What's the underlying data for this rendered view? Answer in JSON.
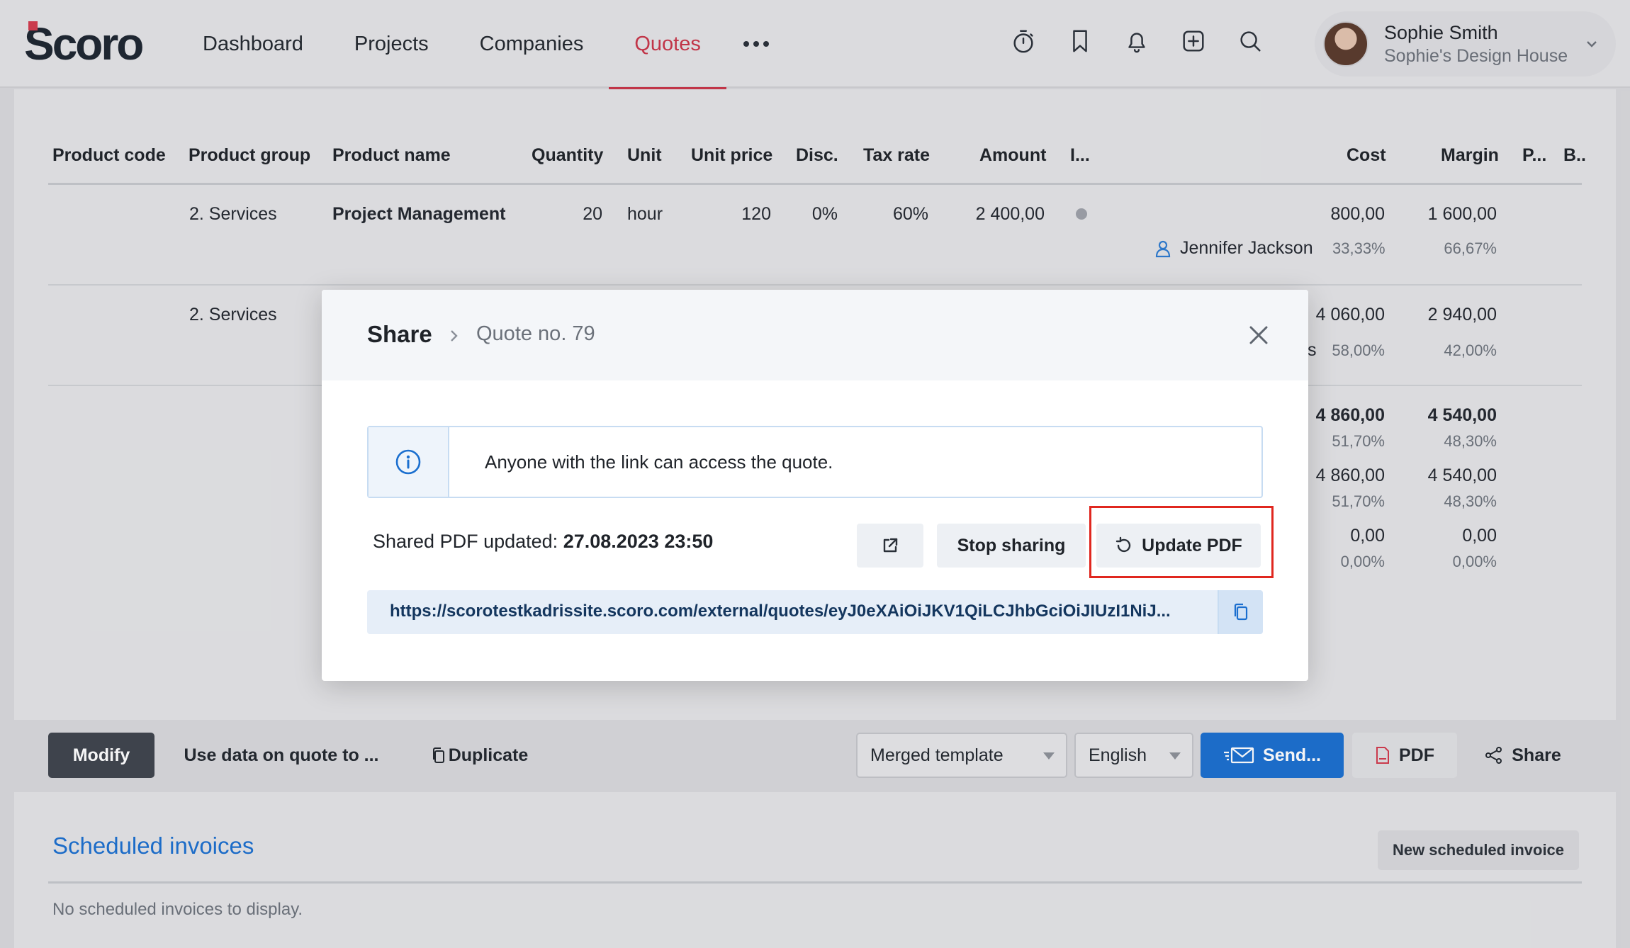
{
  "app": {
    "logo": "Scoro"
  },
  "nav": {
    "items": [
      "Dashboard",
      "Projects",
      "Companies",
      "Quotes"
    ],
    "active": "Quotes"
  },
  "user": {
    "name": "Sophie Smith",
    "company": "Sophie's Design House"
  },
  "table": {
    "headers": [
      "Product code",
      "Product group",
      "Product name",
      "Quantity",
      "Unit",
      "Unit price",
      "Disc.",
      "Tax rate",
      "Amount",
      "I...",
      "Cost",
      "Margin",
      "P...",
      "B.."
    ],
    "rows": [
      {
        "group": "2. Services",
        "name": "Project Management",
        "quantity": "20",
        "unit": "hour",
        "unit_price": "120",
        "discount": "0%",
        "tax_rate": "60%",
        "amount": "2 400,00",
        "cost": "800,00",
        "margin": "1 600,00",
        "person": "Jennifer Jackson",
        "cost_pct": "33,33%",
        "margin_pct": "66,67%"
      },
      {
        "group": "2. Services",
        "cost": "4 060,00",
        "margin": "2 940,00",
        "person_tail": "s",
        "cost_pct": "58,00%",
        "margin_pct": "42,00%"
      }
    ],
    "totals": [
      {
        "cost": "4 860,00",
        "margin": "4 540,00",
        "cost_pct": "51,70%",
        "margin_pct": "48,30%"
      },
      {
        "cost": "4 860,00",
        "margin": "4 540,00",
        "cost_pct": "51,70%",
        "margin_pct": "48,30%"
      },
      {
        "cost": "0,00",
        "margin": "0,00",
        "cost_pct": "0,00%",
        "margin_pct": "0,00%"
      }
    ]
  },
  "toolbar": {
    "modify": "Modify",
    "use_data": "Use data on quote to ...",
    "duplicate": "Duplicate",
    "template": "Merged template",
    "language": "English",
    "send": "Send...",
    "pdf": "PDF",
    "share": "Share"
  },
  "scheduled": {
    "title": "Scheduled invoices",
    "new_button": "New scheduled invoice",
    "empty": "No scheduled invoices to display."
  },
  "modal": {
    "title": "Share",
    "breadcrumb": "Quote no. 79",
    "info": "Anyone with the link can access the quote.",
    "shared_label": "Shared PDF updated:",
    "shared_date": "27.08.2023 23:50",
    "stop_sharing": "Stop sharing",
    "update_pdf": "Update PDF",
    "url": "https://scorotestkadrissite.scoro.com/external/quotes/eyJ0eXAiOiJKV1QiLCJhbGciOiJIUzI1NiJ...",
    "highlight_color": "#e0271f"
  }
}
